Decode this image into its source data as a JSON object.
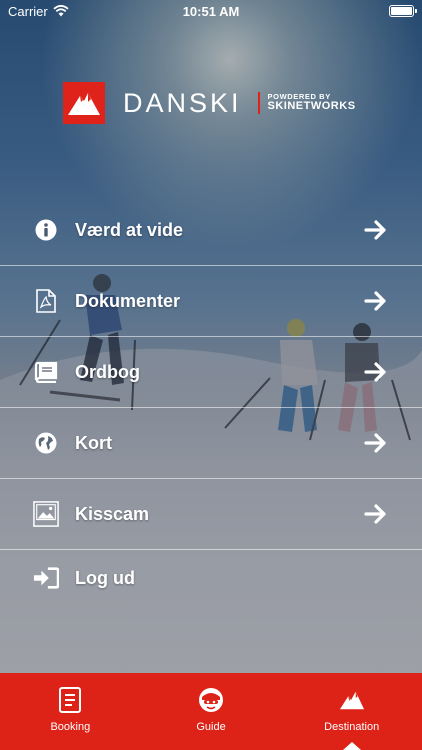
{
  "status_bar": {
    "carrier": "Carrier",
    "time": "10:51 AM"
  },
  "logo": {
    "wordmark": "DANSKI",
    "powered_by": "POWDERED BY",
    "partner": "SKINETWORKS"
  },
  "menu": {
    "items": [
      {
        "label": "Værd at vide",
        "icon": "info-icon"
      },
      {
        "label": "Dokumenter",
        "icon": "pdf-document-icon"
      },
      {
        "label": "Ordbog",
        "icon": "book-icon"
      },
      {
        "label": "Kort",
        "icon": "globe-icon"
      },
      {
        "label": "Kisscam",
        "icon": "image-icon"
      },
      {
        "label": "Log ud",
        "icon": "logout-icon"
      }
    ]
  },
  "tabbar": {
    "tabs": [
      {
        "label": "Booking",
        "icon": "document-icon"
      },
      {
        "label": "Guide",
        "icon": "guide-avatar-icon"
      },
      {
        "label": "Destination",
        "icon": "mountain-icon",
        "selected": true
      }
    ]
  },
  "colors": {
    "brand_red": "#dd2217",
    "text": "#ffffff"
  }
}
